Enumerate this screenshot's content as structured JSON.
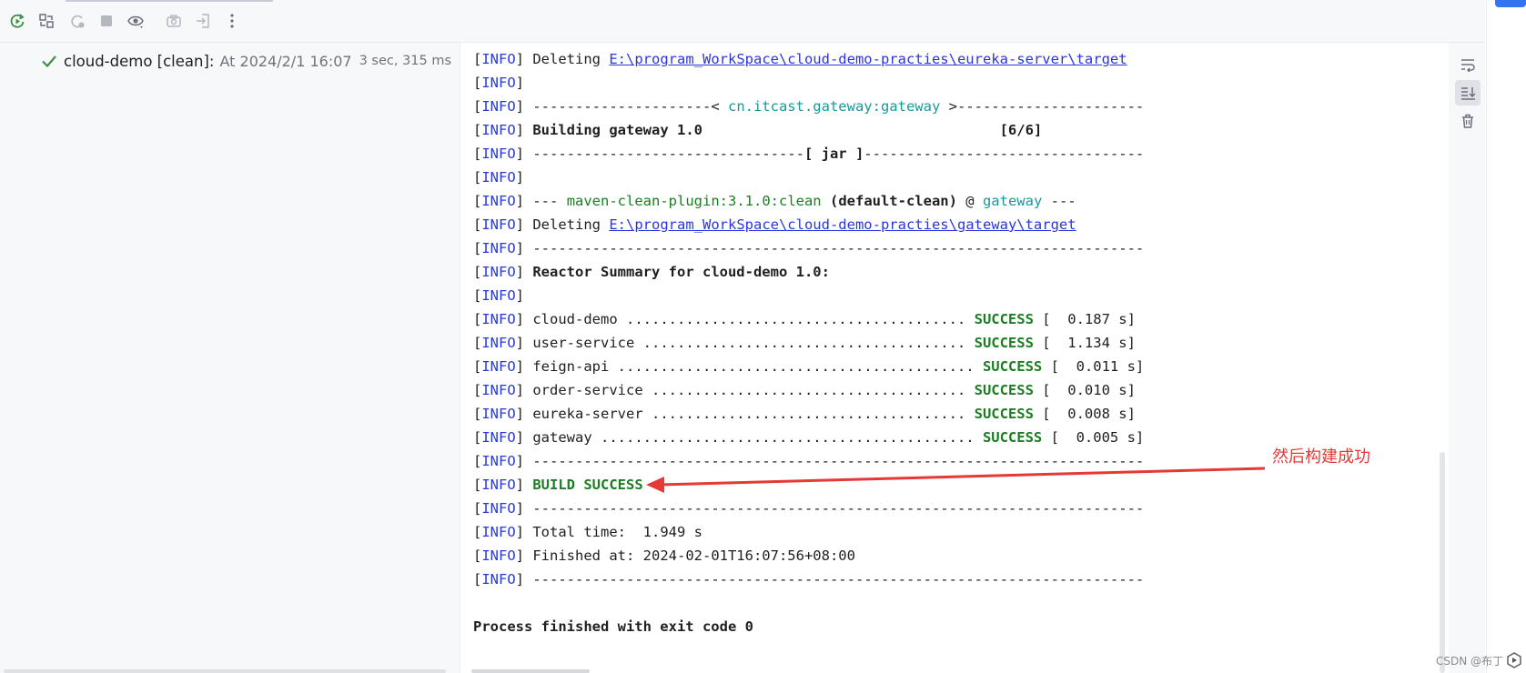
{
  "tree": {
    "name": "cloud-demo [clean]:",
    "time": "At 2024/2/1 16:07",
    "duration": "3 sec, 315 ms"
  },
  "icons": {
    "toolbar": [
      "rerun-icon",
      "rerun-failed-icon",
      "toggle-offline-icon",
      "stop-icon",
      "show-icon",
      "screenshot-icon",
      "attach-icon",
      "more-icon"
    ],
    "side": [
      "soft-wrap-icon",
      "scroll-to-end-icon",
      "clear-trash-icon"
    ],
    "status": "success-check-icon"
  },
  "console": {
    "info_tag": "INFO",
    "lines": {
      "l1_text": " Deleting ",
      "l1_link": "E:\\program_WorkSpace\\cloud-demo-practies\\eureka-server\\target",
      "l3_dashes_a": " ---------------------< ",
      "l3_artifact": "cn.itcast.gateway:gateway",
      "l3_dashes_b": " >----------------------",
      "l4_text": " Building gateway 1.0                                   [6/6]",
      "l5_dashes_a": " --------------------------------",
      "l5_jar": "[ jar ]",
      "l5_dashes_b": "---------------------------------",
      "l7_dashes_a": " --- ",
      "l7_plugin": "maven-clean-plugin:3.1.0:clean",
      "l7_goal": " (default-clean)",
      "l7_at": " @ ",
      "l7_module": "gateway",
      "l7_dashes_b": " ---",
      "l8_text": " Deleting ",
      "l8_link": "E:\\program_WorkSpace\\cloud-demo-practies\\gateway\\target",
      "dashes_full": " ------------------------------------------------------------------------",
      "l10_text": " Reactor Summary for cloud-demo 1.0:",
      "build_success": "BUILD SUCCESS",
      "total_time": " Total time:  1.949 s",
      "finished_at": " Finished at: 2024-02-01T16:07:56+08:00",
      "process_exit": "Process finished with exit code 0"
    },
    "summary": [
      {
        "dots": " cloud-demo ........................................ ",
        "status": "SUCCESS",
        "time": " [  0.187 s]"
      },
      {
        "dots": " user-service ...................................... ",
        "status": "SUCCESS",
        "time": " [  1.134 s]"
      },
      {
        "dots": " feign-api .......................................... ",
        "status": "SUCCESS",
        "time": " [  0.011 s]"
      },
      {
        "dots": " order-service ..................................... ",
        "status": "SUCCESS",
        "time": " [  0.010 s]"
      },
      {
        "dots": " eureka-server ..................................... ",
        "status": "SUCCESS",
        "time": " [  0.008 s]"
      },
      {
        "dots": " gateway ............................................ ",
        "status": "SUCCESS",
        "time": " [  0.005 s]"
      }
    ]
  },
  "annotation": {
    "text": "然后构建成功"
  },
  "watermark": {
    "text": "CSDN @布丁"
  },
  "colors": {
    "info": "#2a3bd5",
    "success": "#1b7e23",
    "link": "#2a35e0",
    "teal": "#17999a",
    "annotation": "#e53935"
  }
}
